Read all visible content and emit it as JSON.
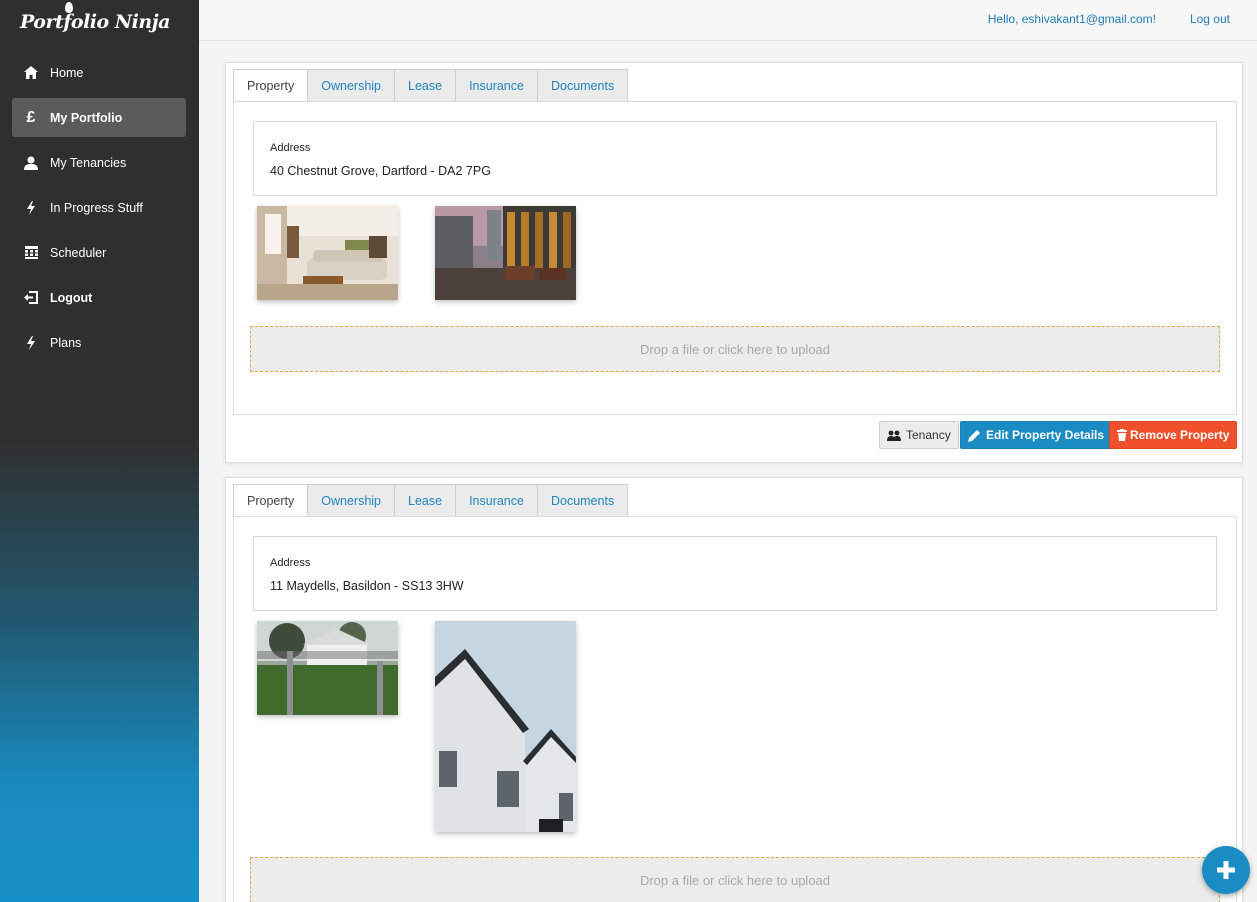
{
  "app": {
    "logo_text": "Portfolio Ninja"
  },
  "sidebar": {
    "items": [
      {
        "label": "Home",
        "icon": "home-icon"
      },
      {
        "label": "My Portfolio",
        "icon": "pound-icon",
        "active": true
      },
      {
        "label": "My Tenancies",
        "icon": "user-icon"
      },
      {
        "label": "In Progress Stuff",
        "icon": "bolt-icon"
      },
      {
        "label": "Scheduler",
        "icon": "calendar-icon"
      },
      {
        "label": "Logout",
        "icon": "logout-icon"
      },
      {
        "label": "Plans",
        "icon": "bolt-icon"
      }
    ]
  },
  "header": {
    "greeting": "Hello, eshivakant1@gmail.com!",
    "logout_label": "Log out"
  },
  "tabs": [
    "Property",
    "Ownership",
    "Lease",
    "Insurance",
    "Documents"
  ],
  "properties": [
    {
      "address_label": "Address",
      "address": "40 Chestnut Grove, Dartford - DA2 7PG",
      "dropzone_text": "Drop a file or click here to upload",
      "photos": [
        "living-room-photo",
        "balcony-photo"
      ]
    },
    {
      "address_label": "Address",
      "address": "11 Maydells, Basildon - SS13 3HW",
      "dropzone_text": "Drop a file or click here to upload",
      "photos": [
        "gate-photo",
        "house-photo"
      ]
    }
  ],
  "actions": {
    "tenancy_label": "Tenancy",
    "edit_label": "Edit Property Details",
    "remove_label": "Remove Property"
  },
  "colors": {
    "accent": "#1b8cc3",
    "danger": "#f0502c",
    "sidebar_dark": "#2f2f2f",
    "sidebar_blue": "#1690c8"
  }
}
